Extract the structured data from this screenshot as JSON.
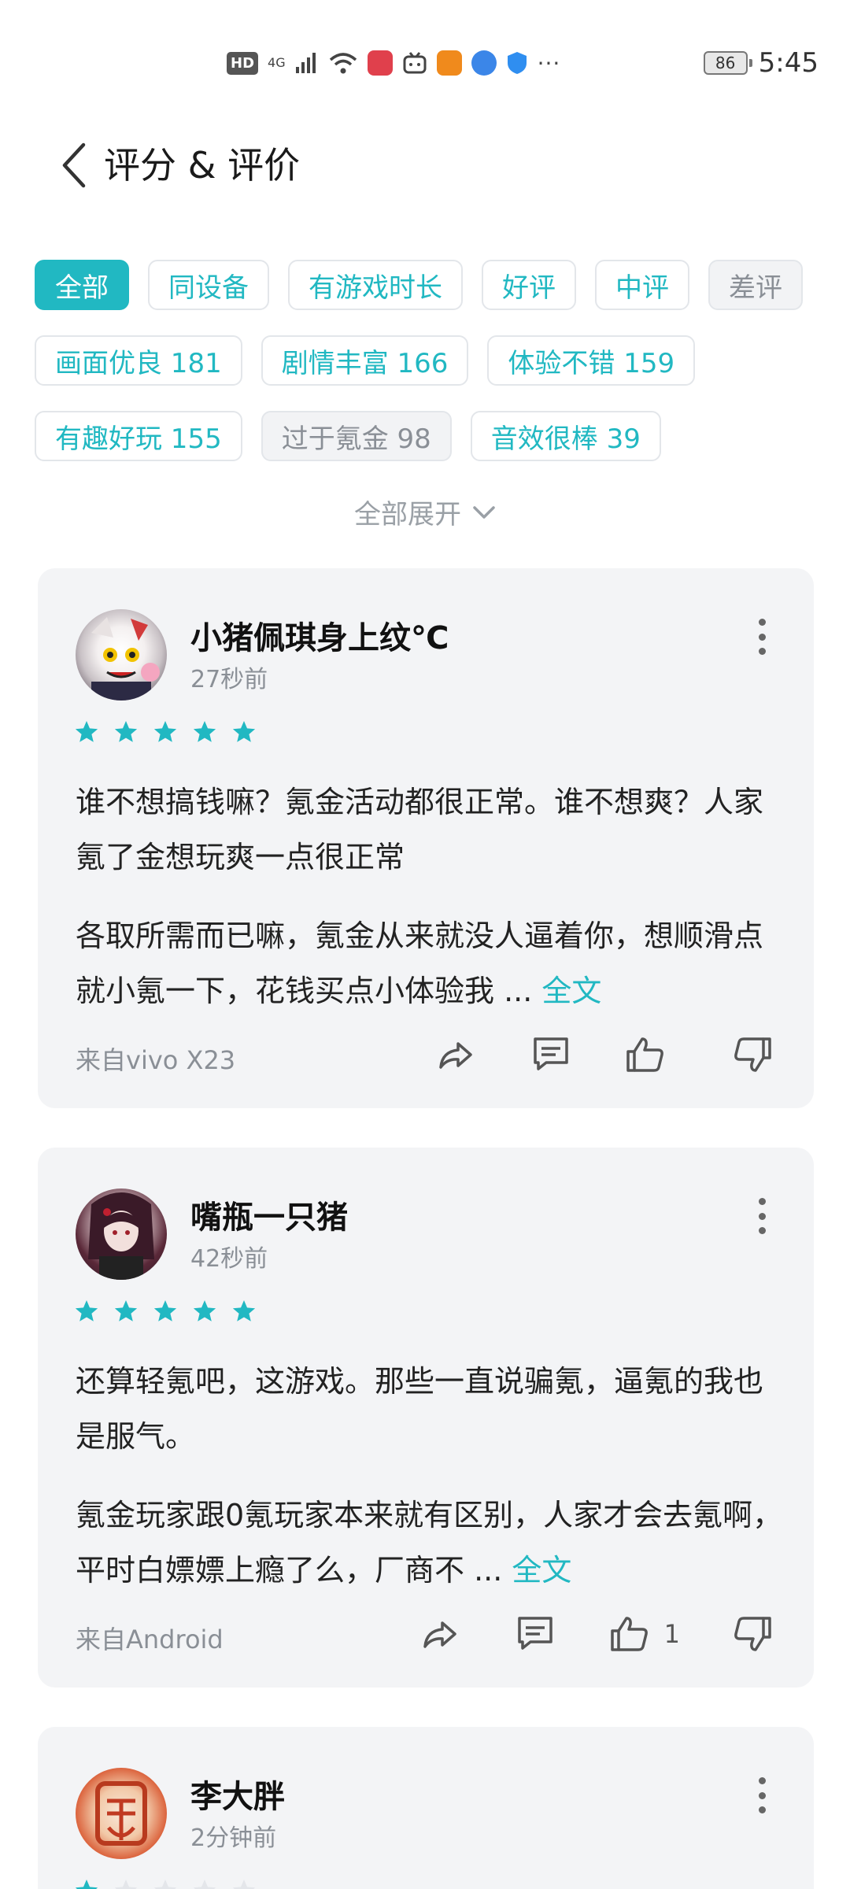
{
  "status_bar": {
    "hd": "HD",
    "network": "4G",
    "battery": "86",
    "time": "5:45"
  },
  "header": {
    "title": "评分 & 评价"
  },
  "filters": {
    "row1": [
      {
        "label": "全部",
        "style": "active"
      },
      {
        "label": "同设备",
        "style": "normal"
      },
      {
        "label": "有游戏时长",
        "style": "normal"
      },
      {
        "label": "好评",
        "style": "normal"
      },
      {
        "label": "中评",
        "style": "normal"
      },
      {
        "label": "差评",
        "style": "gray"
      }
    ],
    "row2": [
      {
        "label": "画面优良 181",
        "style": "normal"
      },
      {
        "label": "剧情丰富 166",
        "style": "normal"
      },
      {
        "label": "体验不错 159",
        "style": "normal"
      }
    ],
    "row3": [
      {
        "label": "有趣好玩 155",
        "style": "normal"
      },
      {
        "label": "过于氪金 98",
        "style": "gray"
      },
      {
        "label": "音效很棒 39",
        "style": "normal"
      }
    ],
    "expand_label": "全部展开"
  },
  "reviews": [
    {
      "user": "小猪佩琪身上纹℃",
      "time": "27秒前",
      "rating": 5,
      "title_text": "谁不想搞钱嘛？氪金活动都很正常。谁不想爽？人家氪了金想玩爽一点很正常",
      "body_text": "各取所需而已嘛，氪金从来就没人逼着你，想顺滑点就小氪一下，花钱买点小体验我 ... ",
      "full_label": "全文",
      "device": "来自vivo X23",
      "likes": ""
    },
    {
      "user": "嘴瓶一只猪",
      "time": "42秒前",
      "rating": 5,
      "title_text": "还算轻氪吧，这游戏。那些一直说骗氪，逼氪的我也是服气。",
      "body_text": "氪金玩家跟0氪玩家本来就有区别，人家才会去氪啊，平时白嫖嫖上瘾了么，厂商不 ... ",
      "full_label": "全文",
      "device": "来自Android",
      "likes": "1"
    },
    {
      "user": "李大胖",
      "time": "2分钟前",
      "rating": 1
    }
  ],
  "colors": {
    "accent": "#21b8c2",
    "card_bg": "#f3f4f6",
    "muted": "#8a8f96"
  }
}
